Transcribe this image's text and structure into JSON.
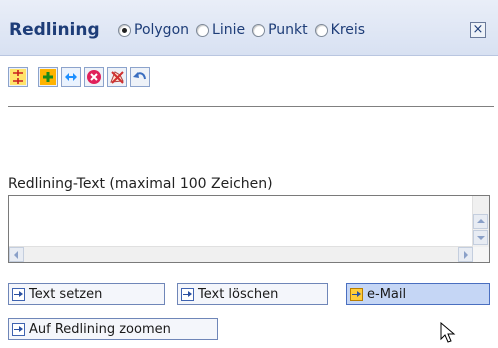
{
  "header": {
    "title": "Redlining",
    "radio_options": [
      {
        "label": "Polygon",
        "checked": true
      },
      {
        "label": "Linie",
        "checked": false
      },
      {
        "label": "Punkt",
        "checked": false
      },
      {
        "label": "Kreis",
        "checked": false
      }
    ],
    "close_symbol": "×"
  },
  "toolbar": {
    "buttons": [
      {
        "icon": "distance-icon",
        "color": "#ffd400"
      },
      {
        "icon": "add-vertex-icon",
        "color": "#ffb300"
      },
      {
        "icon": "move-horizontal-icon",
        "color": "#1c8fff"
      },
      {
        "icon": "delete-icon",
        "color": "#e0205a"
      },
      {
        "icon": "delete-shape-icon",
        "color": "#d03030"
      },
      {
        "icon": "undo-icon",
        "color": "#3a6ec0"
      }
    ]
  },
  "text_section": {
    "label": "Redlining-Text (maximal 100 Zeichen)",
    "value": ""
  },
  "buttons": {
    "set_text": "Text setzen",
    "delete_text": "Text löschen",
    "email": "e-Mail",
    "zoom": "Auf Redlining zoomen"
  },
  "colors": {
    "title": "#1e3d78",
    "header_bg": "#dfe6f5",
    "button_hover_bg": "#c5d6f5"
  }
}
